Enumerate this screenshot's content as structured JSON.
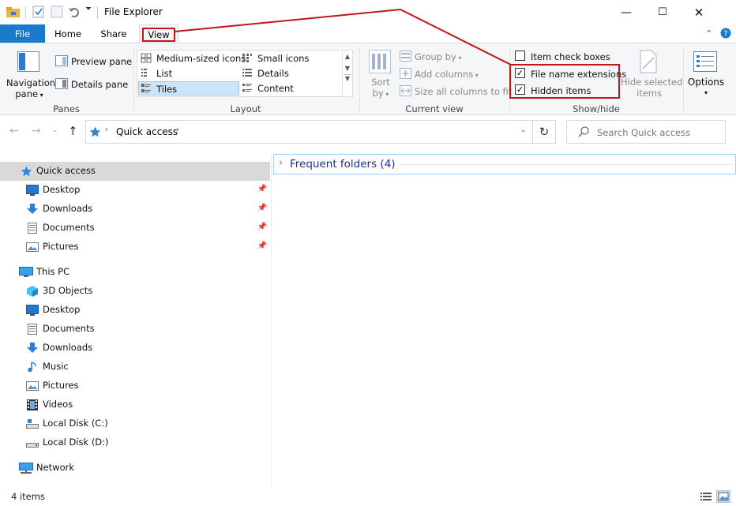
{
  "window": {
    "title": "File Explorer",
    "controls": {
      "minimize": "—",
      "maximize": "☐",
      "close": "✕"
    }
  },
  "ribbon": {
    "tabs": {
      "file": "File",
      "home": "Home",
      "share": "Share",
      "view": "View"
    },
    "panes": {
      "navigation_pane_1": "Navigation",
      "navigation_pane_2": "pane",
      "preview_pane": "Preview pane",
      "details_pane": "Details pane",
      "group_label": "Panes"
    },
    "layout": {
      "medium_icons": "Medium-sized icons",
      "small_icons": "Small icons",
      "list": "List",
      "details": "Details",
      "tiles": "Tiles",
      "content": "Content",
      "group_label": "Layout"
    },
    "current_view": {
      "sort_1": "Sort",
      "sort_2": "by",
      "group_by": "Group by",
      "add_columns": "Add columns",
      "size_all": "Size all columns to fit",
      "group_label": "Current view"
    },
    "show_hide": {
      "item_check_boxes": "Item check boxes",
      "item_check_boxes_checked": false,
      "file_name_extensions": "File name extensions",
      "file_name_extensions_checked": true,
      "hidden_items": "Hidden items",
      "hidden_items_checked": true,
      "hide_selected_1": "Hide selected",
      "hide_selected_2": "items",
      "group_label": "Show/hide"
    },
    "options": "Options"
  },
  "address": {
    "location": "Quick access",
    "search_placeholder": "Search Quick access"
  },
  "nav": {
    "quick_access": "Quick access",
    "qa_items": [
      "Desktop",
      "Downloads",
      "Documents",
      "Pictures"
    ],
    "this_pc": "This PC",
    "pc_items": [
      "3D Objects",
      "Desktop",
      "Documents",
      "Downloads",
      "Music",
      "Pictures",
      "Videos",
      "Local Disk (C:)",
      "Local Disk (D:)"
    ],
    "network": "Network"
  },
  "content": {
    "frequent_folders": "Frequent folders (4)"
  },
  "status": {
    "item_count": "4 items"
  },
  "colors": {
    "accent": "#1979ca",
    "annotation": "#c0161b",
    "selected_row": "#d9d9d9"
  }
}
